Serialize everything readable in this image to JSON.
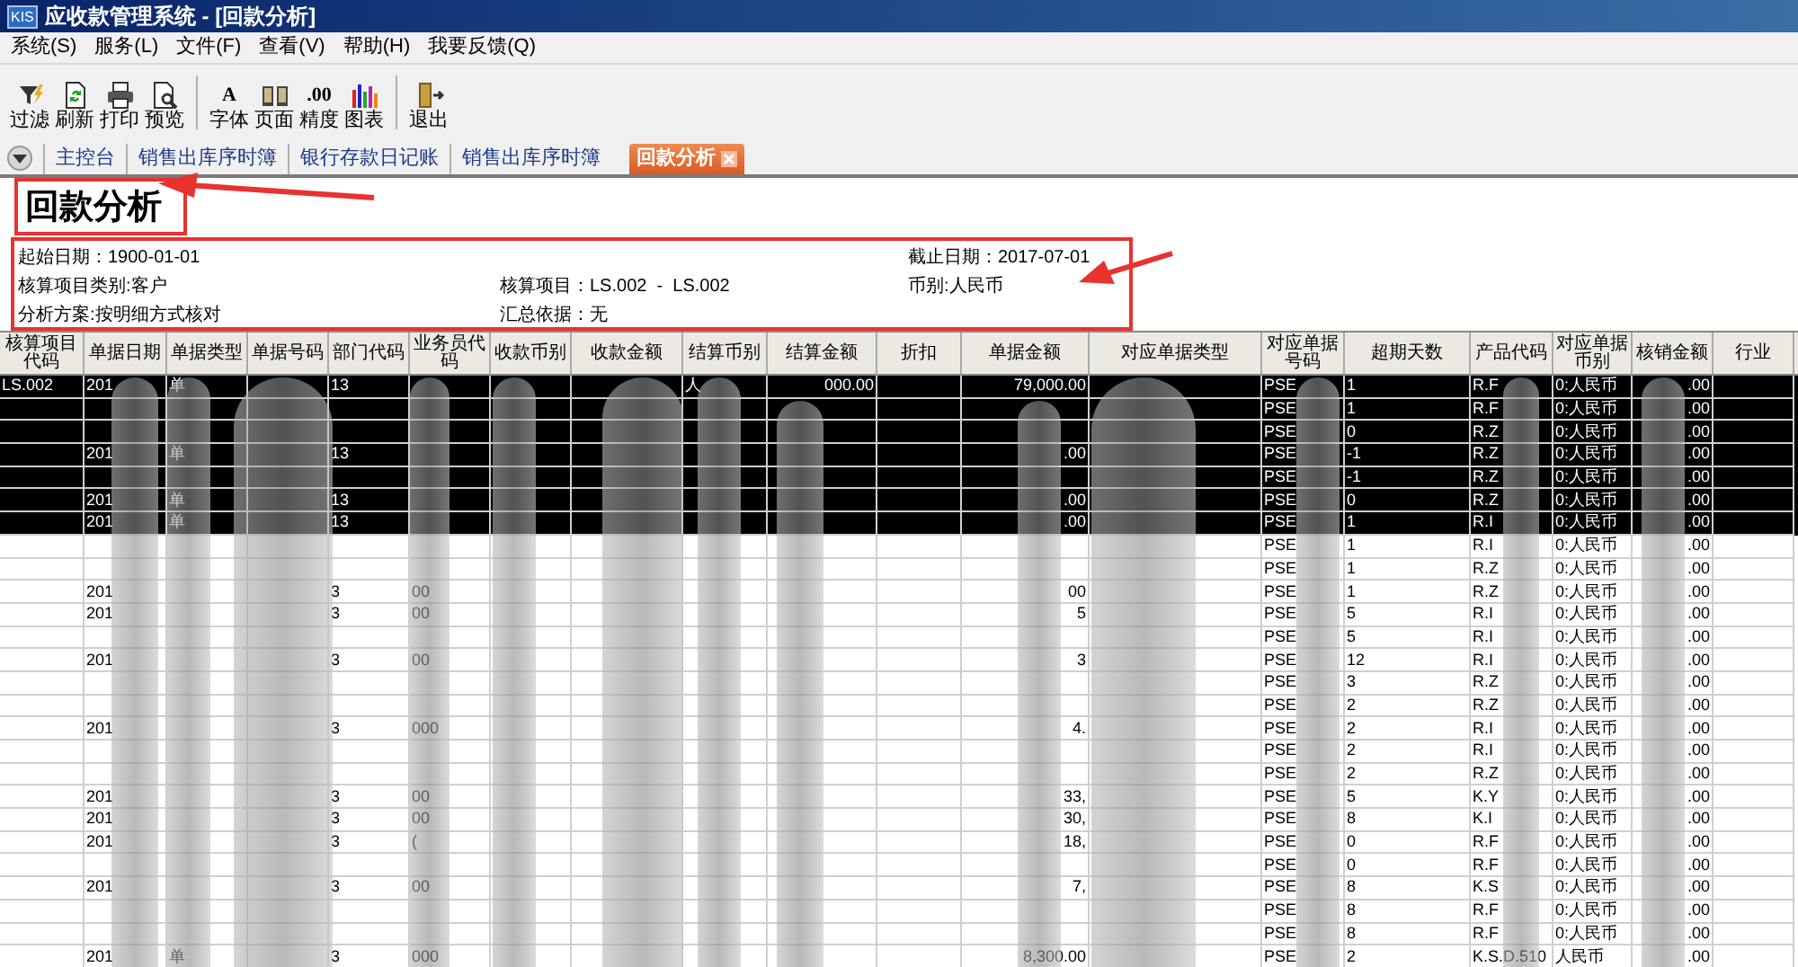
{
  "window": {
    "logo": "KIS",
    "title": "应收款管理系统 - [回款分析]"
  },
  "menu": [
    "系统(S)",
    "服务(L)",
    "文件(F)",
    "查看(V)",
    "帮助(H)",
    "我要反馈(Q)"
  ],
  "toolbar": [
    {
      "label": "过滤"
    },
    {
      "label": "刷新"
    },
    {
      "label": "打印"
    },
    {
      "label": "预览",
      "separator_after": true
    },
    {
      "label": "字体",
      "glyph": "A"
    },
    {
      "label": "页面"
    },
    {
      "label": "精度",
      "glyph": ".00"
    },
    {
      "label": "图表",
      "separator_after": true
    },
    {
      "label": "退出"
    }
  ],
  "tabs": [
    {
      "label": "主控台",
      "selected": false
    },
    {
      "label": "销售出库序时簿",
      "selected": false
    },
    {
      "label": "银行存款日记账",
      "selected": false
    },
    {
      "label": "销售出库序时簿",
      "selected": false
    },
    {
      "label": "回款分析",
      "selected": true
    }
  ],
  "report": {
    "title": "回款分析",
    "filter_lines": [
      {
        "left": "起始日期：1900-01-01",
        "right": "截止日期：2017-07-01"
      },
      {
        "left": "核算项目类别:客户",
        "middle": "核算项目：LS.002  -  LS.002",
        "right": "币别:人民币"
      },
      {
        "left": "分析方案:按明细方式核对",
        "middle": "汇总依据：无"
      }
    ]
  },
  "table": {
    "columns": [
      "核算项目代码",
      "单据日期",
      "单据类型",
      "单据号码",
      "部门代码",
      "业务员代码",
      "收款币别",
      "收款金额",
      "结算币别",
      "结算金额",
      "折扣",
      "单据金额",
      "对应单据类型",
      "对应单据号码",
      "超期天数",
      "产品代码",
      "对应单据币别",
      "核销金额",
      "行业"
    ],
    "rows": [
      {
        "selected": true,
        "cells": [
          "LS.002",
          "201",
          "单",
          null,
          "13",
          null,
          null,
          null,
          "人",
          "000.00",
          null,
          "79,000.00",
          null,
          "PSE",
          "1",
          "R.F",
          "0:人民币",
          ".00",
          null
        ]
      },
      {
        "selected": true,
        "cells": [
          null,
          null,
          null,
          null,
          null,
          null,
          null,
          null,
          null,
          null,
          null,
          null,
          null,
          "PSE",
          "1",
          "R.F",
          "0:人民币",
          ".00",
          null
        ]
      },
      {
        "selected": true,
        "cells": [
          null,
          null,
          null,
          null,
          null,
          null,
          null,
          null,
          null,
          null,
          null,
          null,
          null,
          "PSE",
          "0",
          "R.Z",
          "0:人民币",
          ".00",
          null
        ]
      },
      {
        "selected": true,
        "cells": [
          null,
          "201",
          "单",
          null,
          "13",
          null,
          null,
          null,
          null,
          null,
          null,
          ".00",
          null,
          "PSE",
          "-1",
          "R.Z",
          "0:人民币",
          ".00",
          null
        ]
      },
      {
        "selected": true,
        "cells": [
          null,
          null,
          null,
          null,
          null,
          null,
          null,
          null,
          null,
          null,
          null,
          null,
          null,
          "PSE",
          "-1",
          "R.Z",
          "0:人民币",
          ".00",
          null
        ]
      },
      {
        "selected": true,
        "cells": [
          null,
          "201",
          "单",
          null,
          "13",
          null,
          null,
          null,
          null,
          null,
          null,
          ".00",
          null,
          "PSE",
          "0",
          "R.Z",
          "0:人民币",
          ".00",
          null
        ]
      },
      {
        "selected": true,
        "cells": [
          null,
          "201",
          "单",
          null,
          "13",
          null,
          null,
          null,
          null,
          null,
          null,
          ".00",
          null,
          "PSE",
          "1",
          "R.I",
          "0:人民币",
          ".00",
          null
        ]
      },
      {
        "selected": false,
        "cells": [
          null,
          null,
          null,
          null,
          null,
          null,
          null,
          null,
          null,
          null,
          null,
          null,
          null,
          "PSE",
          "1",
          "R.I",
          "0:人民币",
          ".00",
          null
        ]
      },
      {
        "selected": false,
        "cells": [
          null,
          null,
          null,
          null,
          null,
          null,
          null,
          null,
          null,
          null,
          null,
          null,
          null,
          "PSE",
          "1",
          "R.Z",
          "0:人民币",
          ".00",
          null
        ]
      },
      {
        "selected": false,
        "cells": [
          null,
          "201",
          null,
          null,
          "3",
          "00",
          null,
          null,
          null,
          null,
          null,
          "00",
          null,
          "PSE",
          "1",
          "R.Z",
          "0:人民币",
          ".00",
          null
        ]
      },
      {
        "selected": false,
        "cells": [
          null,
          "201",
          null,
          null,
          "3",
          "00",
          null,
          null,
          null,
          null,
          null,
          "5",
          null,
          "PSE",
          "5",
          "R.I",
          "0:人民币",
          ".00",
          null
        ]
      },
      {
        "selected": false,
        "cells": [
          null,
          null,
          null,
          null,
          null,
          null,
          null,
          null,
          null,
          null,
          null,
          null,
          null,
          "PSE",
          "5",
          "R.I",
          "0:人民币",
          ".00",
          null
        ]
      },
      {
        "selected": false,
        "cells": [
          null,
          "201",
          null,
          null,
          "3",
          "00",
          null,
          null,
          null,
          null,
          null,
          "3",
          null,
          "PSE",
          "12",
          "R.I",
          "0:人民币",
          ".00",
          null
        ]
      },
      {
        "selected": false,
        "cells": [
          null,
          null,
          null,
          null,
          null,
          null,
          null,
          null,
          null,
          null,
          null,
          null,
          null,
          "PSE",
          "3",
          "R.Z",
          "0:人民币",
          ".00",
          null
        ]
      },
      {
        "selected": false,
        "cells": [
          null,
          null,
          null,
          null,
          null,
          null,
          null,
          null,
          null,
          null,
          null,
          null,
          null,
          "PSE",
          "2",
          "R.Z",
          "0:人民币",
          ".00",
          null
        ]
      },
      {
        "selected": false,
        "cells": [
          null,
          "201",
          null,
          null,
          "3",
          "000",
          null,
          null,
          null,
          null,
          null,
          "4.",
          null,
          "PSE",
          "2",
          "R.I",
          "0:人民币",
          ".00",
          null
        ]
      },
      {
        "selected": false,
        "cells": [
          null,
          null,
          null,
          null,
          null,
          null,
          null,
          null,
          null,
          null,
          null,
          null,
          null,
          "PSE",
          "2",
          "R.I",
          "0:人民币",
          ".00",
          null
        ]
      },
      {
        "selected": false,
        "cells": [
          null,
          null,
          null,
          null,
          null,
          null,
          null,
          null,
          null,
          null,
          null,
          null,
          null,
          "PSE",
          "2",
          "R.Z",
          "0:人民币",
          ".00",
          null
        ]
      },
      {
        "selected": false,
        "cells": [
          null,
          "201",
          null,
          null,
          "3",
          "00",
          null,
          null,
          null,
          null,
          null,
          "33,",
          null,
          "PSE",
          "5",
          "K.Y",
          "0:人民币",
          ".00",
          null
        ]
      },
      {
        "selected": false,
        "cells": [
          null,
          "201",
          null,
          null,
          "3",
          "00",
          null,
          null,
          null,
          null,
          null,
          "30,",
          null,
          "PSE",
          "8",
          "K.I",
          "0:人民币",
          ".00",
          null
        ]
      },
      {
        "selected": false,
        "cells": [
          null,
          "201",
          null,
          null,
          "3",
          "(",
          null,
          null,
          null,
          null,
          null,
          "18,",
          null,
          "PSE",
          "0",
          "R.F",
          "0:人民币",
          ".00",
          null
        ]
      },
      {
        "selected": false,
        "cells": [
          null,
          null,
          null,
          null,
          null,
          null,
          null,
          null,
          null,
          null,
          null,
          null,
          null,
          "PSE",
          "0",
          "R.F",
          "0:人民币",
          ".00",
          null
        ]
      },
      {
        "selected": false,
        "cells": [
          null,
          "201",
          null,
          null,
          "3",
          "00",
          null,
          null,
          null,
          null,
          null,
          "7,",
          null,
          "PSE",
          "8",
          "K.S",
          "0:人民币",
          ".00",
          null
        ]
      },
      {
        "selected": false,
        "cells": [
          null,
          null,
          null,
          null,
          null,
          null,
          null,
          null,
          null,
          null,
          null,
          null,
          null,
          "PSE",
          "8",
          "R.F",
          "0:人民币",
          ".00",
          null
        ]
      },
      {
        "selected": false,
        "cells": [
          null,
          null,
          null,
          null,
          null,
          null,
          null,
          null,
          null,
          null,
          null,
          null,
          null,
          "PSE",
          "8",
          "R.F",
          "0:人民币",
          ".00",
          null
        ]
      },
      {
        "selected": false,
        "cells": [
          null,
          "201",
          "单",
          null,
          "3",
          "000",
          null,
          null,
          null,
          null,
          null,
          "8,300.00",
          null,
          "PSE",
          "2",
          "K.S.D.510",
          "人民币",
          ".00",
          null
        ]
      }
    ]
  }
}
